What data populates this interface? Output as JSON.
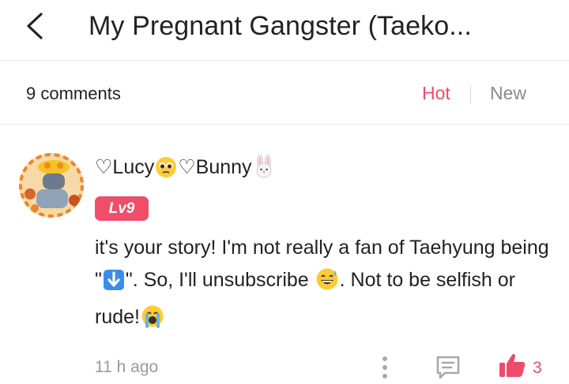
{
  "header": {
    "title": "My Pregnant Gangster (Taeko...",
    "back_icon": "chevron-left-icon"
  },
  "comments_bar": {
    "count_label": "9 comments",
    "sort_hot": "Hot",
    "sort_new": "New",
    "active_color": "#ef4a67"
  },
  "comment": {
    "user_part1": "♡Lucy",
    "user_part2": "♡Bunny",
    "level": "Lv9",
    "text_part1": "it's your story! I'm not really a fan of Taehyung being \"",
    "text_part2": "\".  So, I'll unsubscribe ",
    "text_part3": ". Not to be selfish or rude!",
    "time": "11 h ago",
    "likes": "3",
    "icons": [
      "pleading-face-emoji",
      "rabbit-face-emoji",
      "down-arrow-emoji",
      "sweat-smile-emoji",
      "crying-face-emoji",
      "more-vertical-icon",
      "reply-icon",
      "thumbs-up-icon"
    ]
  }
}
